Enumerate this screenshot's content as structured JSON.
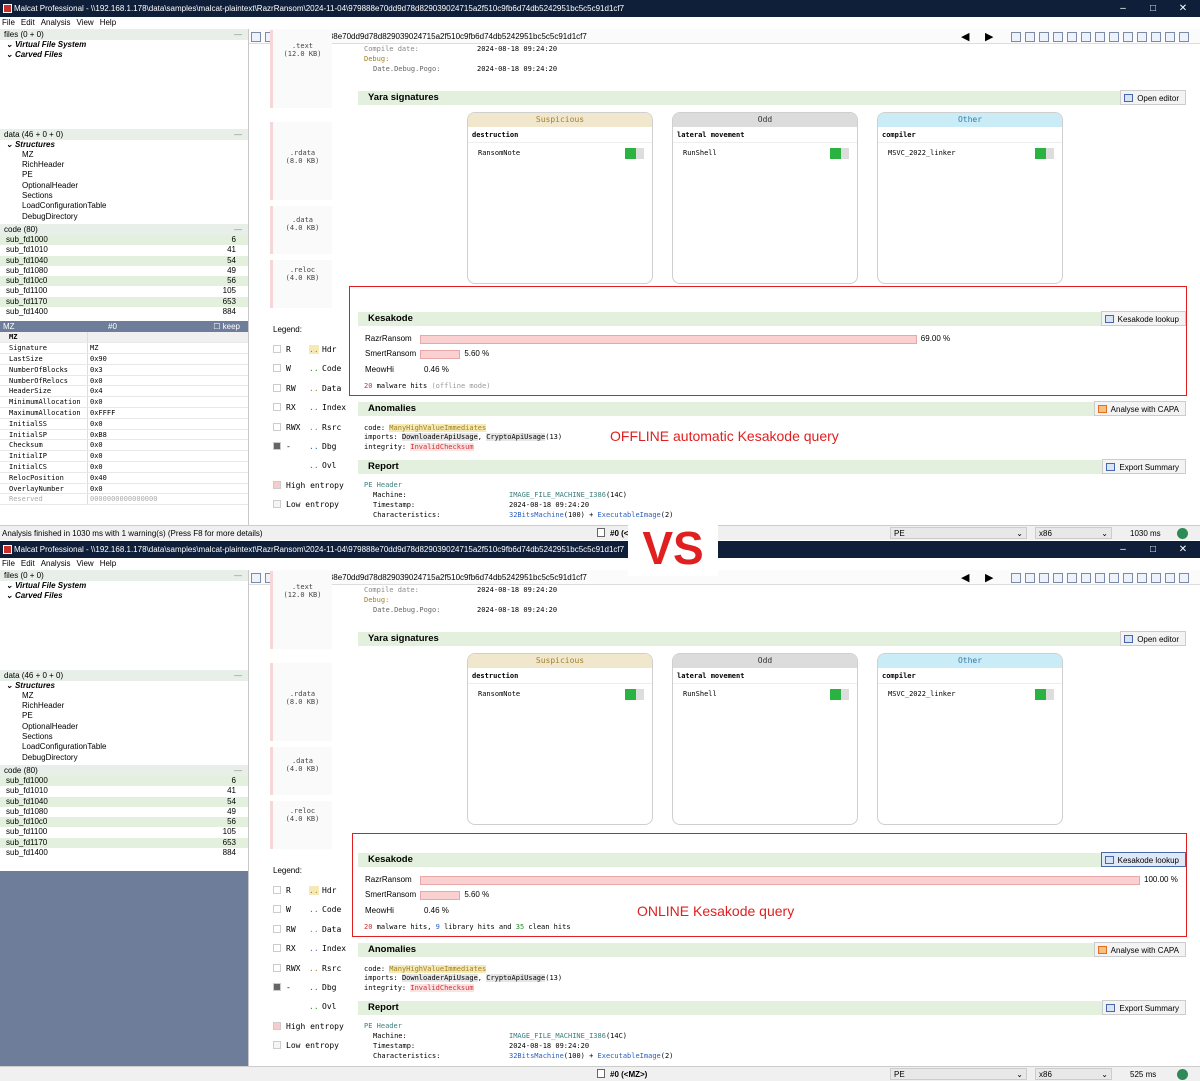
{
  "app": {
    "title": "Malcat Professional - \\\\192.168.1.178\\data\\samples\\malcat-plaintext\\RazrRansom\\2024-11-04\\979888e70dd9d78d829039024715a2f510c9fb6d74db5242951bc5c5c91d1cf7",
    "menu": [
      "File",
      "Edit",
      "Analysis",
      "View",
      "Help"
    ],
    "file_hash": "979888e70dd9d78d829039024715a2f510c9fb6d74db5242951bc5c5c91d1cf7"
  },
  "left": {
    "files_header": "files (0 + 0)",
    "vfs": "Virtual File System",
    "carved": "Carved Files",
    "data_header": "data (46 + 0 + 0)",
    "structures": "Structures",
    "struct_items": [
      "MZ",
      "RichHeader",
      "PE",
      "OptionalHeader",
      "Sections",
      "LoadConfigurationTable",
      "DebugDirectory"
    ],
    "code_header": "code (80)",
    "functions": [
      {
        "name": "sub_fd1000",
        "count": "6"
      },
      {
        "name": "sub_fd1010",
        "count": "41"
      },
      {
        "name": "sub_fd1040",
        "count": "54"
      },
      {
        "name": "sub_fd1080",
        "count": "49"
      },
      {
        "name": "sub_fd10c0",
        "count": "56"
      },
      {
        "name": "sub_fd1100",
        "count": "105"
      },
      {
        "name": "sub_fd1170",
        "count": "653"
      },
      {
        "name": "sub_fd1400",
        "count": "884"
      }
    ],
    "mz_panel": {
      "title": "MZ",
      "index": "#0",
      "keep": "keep",
      "section": "MZ"
    },
    "mz_fields": [
      {
        "k": "Signature",
        "v": "MZ"
      },
      {
        "k": "LastSize",
        "v": "0x90"
      },
      {
        "k": "NumberOfBlocks",
        "v": "0x3"
      },
      {
        "k": "NumberOfRelocs",
        "v": "0x0"
      },
      {
        "k": "HeaderSize",
        "v": "0x4"
      },
      {
        "k": "MinimumAllocation",
        "v": "0x0"
      },
      {
        "k": "MaximumAllocation",
        "v": "0xFFFF"
      },
      {
        "k": "InitialSS",
        "v": "0x0"
      },
      {
        "k": "InitialSP",
        "v": "0xB8"
      },
      {
        "k": "Checksum",
        "v": "0x0"
      },
      {
        "k": "InitialIP",
        "v": "0x0"
      },
      {
        "k": "InitialCS",
        "v": "0x0"
      },
      {
        "k": "RelocPosition",
        "v": "0x40"
      },
      {
        "k": "OverlayNumber",
        "v": "0x0"
      },
      {
        "k": "Reserved",
        "v": "0000000000000000"
      }
    ]
  },
  "sections": [
    {
      "name": ".text",
      "size": "(12.0 KB)"
    },
    {
      "name": ".rdata",
      "size": "(8.0 KB)"
    },
    {
      "name": ".data",
      "size": "(4.0 KB)"
    },
    {
      "name": ".reloc",
      "size": "(4.0 KB)"
    }
  ],
  "header_info": {
    "compile_label": "Compile date:",
    "compile_value": "2024-08-18 09:24:20",
    "debug_label": "Debug:",
    "pogo_label": "Date.Debug.Pogo:",
    "pogo_value": "2024-08-18 09:24:20"
  },
  "yara": {
    "title": "Yara signatures",
    "button": "Open editor",
    "cards": [
      {
        "head": "Suspicious",
        "category": "destruction",
        "rule": "RansomNote"
      },
      {
        "head": "Odd",
        "category": "lateral movement",
        "rule": "RunShell"
      },
      {
        "head": "Other",
        "category": "compiler",
        "rule": "MSVC_2022_linker"
      }
    ]
  },
  "legend": {
    "title": "Legend:",
    "items": [
      {
        "left": "R",
        "right": "Hdr"
      },
      {
        "left": "W",
        "right": "Code"
      },
      {
        "left": "RW",
        "right": "Data"
      },
      {
        "left": "RX",
        "right": "Index"
      },
      {
        "left": "RWX",
        "right": "Rsrc"
      },
      {
        "left": "-",
        "right": "Dbg"
      },
      {
        "left": "",
        "right": "Ovl"
      }
    ],
    "high": "High entropy",
    "low": "Low entropy"
  },
  "kesakode": {
    "title": "Kesakode",
    "button": "Kesakode lookup",
    "offline": {
      "rows": [
        {
          "name": "RazrRansom",
          "pct": "69.00 %",
          "value": 69.0
        },
        {
          "name": "SmertRansom",
          "pct": "5.60 %",
          "value": 5.6
        },
        {
          "name": "MeowHi",
          "pct": "0.46 %",
          "value": 0.46
        }
      ],
      "hits_num": "20",
      "hits_text": " malware hits",
      "hits_mode": "(offline mode)"
    },
    "online": {
      "rows": [
        {
          "name": "RazrRansom",
          "pct": "100.00 %",
          "value": 100.0
        },
        {
          "name": "SmertRansom",
          "pct": "5.60 %",
          "value": 5.6
        },
        {
          "name": "MeowHi",
          "pct": "0.46 %",
          "value": 0.46
        }
      ],
      "hits_num": "20",
      "hits_text": " malware hits, ",
      "lib_num": "9",
      "lib_text": " library hits and ",
      "clean_num": "35",
      "clean_text": " clean hits"
    }
  },
  "anomalies": {
    "title": "Anomalies",
    "button": "Analyse with CAPA",
    "code_label": "code: ",
    "code_value": "ManyHighValueImmediates",
    "imports_label": "imports: ",
    "imports_a": "DownloaderApiUsage",
    "imports_b": "CryptoApiUsage",
    "imports_b_count": "(13)",
    "integrity_label": "integrity: ",
    "integrity_value": "InvalidChecksum"
  },
  "report": {
    "title": "Report",
    "button": "Export Summary",
    "pe_header": "PE Header",
    "machine_label": "Machine:",
    "machine_value": "IMAGE_FILE_MACHINE_I386",
    "machine_code": "(14C)",
    "timestamp_label": "Timestamp:",
    "timestamp_value": "2024-08-18 09:24:20",
    "char_label": "Characteristics:",
    "char_a": "32BitsMachine",
    "char_a_code": "(100)",
    "char_b": "ExecutableImage",
    "char_b_code": "(2)"
  },
  "annotations": {
    "offline": "OFFLINE automatic Kesakode query",
    "online": "ONLINE Kesakode query",
    "vs": "VS"
  },
  "status": {
    "w1_msg": "Analysis finished in 1030 ms with 1 warning(s) (Press F8 for more details)",
    "w1_loc": "#0 (<M",
    "w2_loc": "#0 (<MZ>)",
    "format": "PE",
    "arch": "x86",
    "w1_time": "1030 ms",
    "w2_time": "525 ms"
  },
  "colors": {
    "accent_red": "#e02020",
    "green_match": "#2bb341",
    "kesa_bar": "#fbd0d0",
    "section_bg": "#e3f0de"
  }
}
